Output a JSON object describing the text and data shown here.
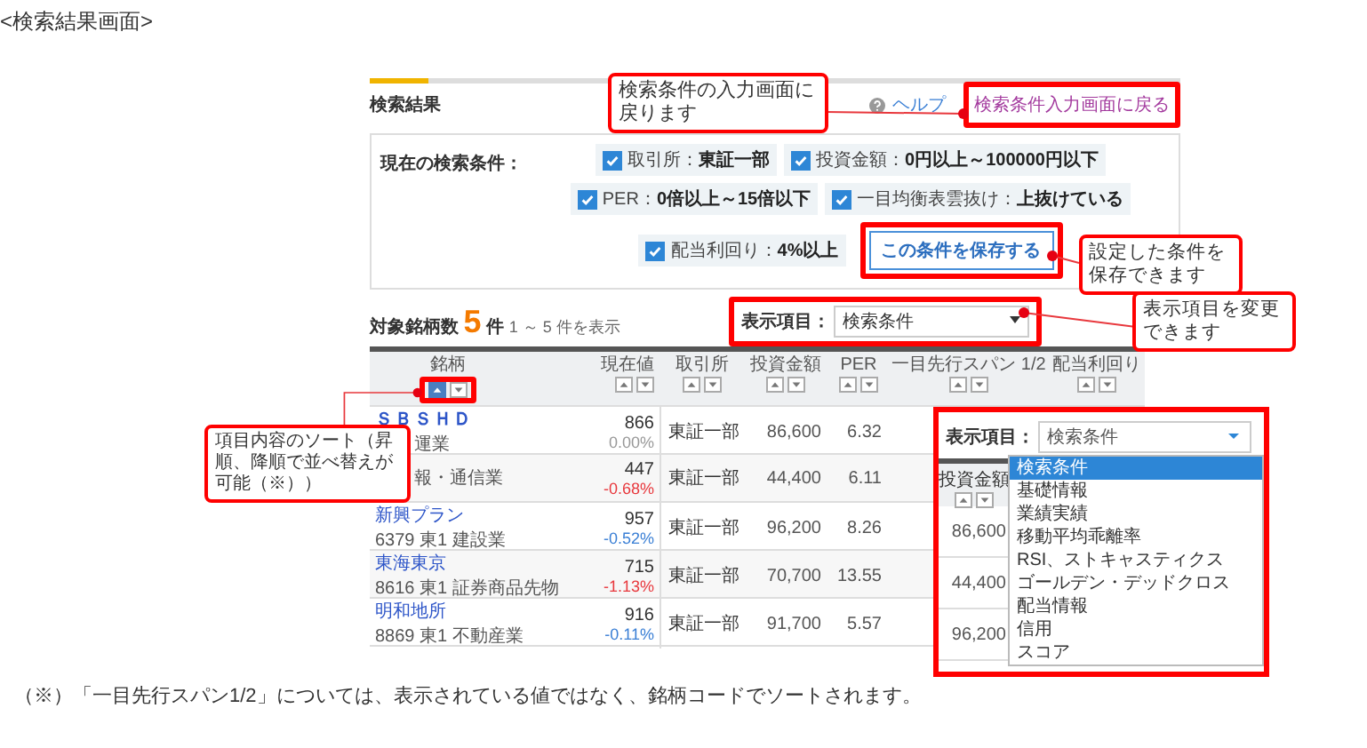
{
  "heading": "<検索結果画面>",
  "panel": {
    "title": "検索結果",
    "help_link": "ヘルプ",
    "back_link": "検索条件入力画面に戻る",
    "conditions": {
      "label": "現在の検索条件：",
      "items": [
        {
          "name": "取引所：",
          "value": "東証一部",
          "checked": true
        },
        {
          "name": "投資金額：",
          "value": "0円以上～100000円以下",
          "checked": true
        },
        {
          "name": "PER：",
          "value": "0倍以上～15倍以下",
          "checked": true
        },
        {
          "name": "一目均衡表雲抜け：",
          "value": "上抜けている",
          "checked": true
        },
        {
          "name": "配当利回り：",
          "value": "4%以上",
          "checked": true
        }
      ],
      "save_button": "この条件を保存する"
    },
    "count": {
      "label": "対象銘柄数",
      "number": "5",
      "unit": "件",
      "range": "1 ～ 5 件を表示"
    },
    "display_select": {
      "label": "表示項目：",
      "value": "検索条件"
    },
    "table": {
      "columns": [
        {
          "label": "銘柄",
          "sorted": true
        },
        {
          "label": "現在値",
          "sorted": false
        },
        {
          "label": "取引所",
          "sorted": false
        },
        {
          "label": "投資金額",
          "sorted": false
        },
        {
          "label": "PER",
          "sorted": false
        },
        {
          "label": "一目先行スパン 1/2",
          "sorted": false
        },
        {
          "label": "配当利回り",
          "sorted": false
        }
      ],
      "rows": [
        {
          "name": "ＳＢＳＨＤ",
          "sub": "運業",
          "covered": true,
          "price": "866",
          "change": "0.00%",
          "color": "#999999",
          "market": "東証一部",
          "amount": "86,600",
          "per": "6.32"
        },
        {
          "sub": "報・通信業",
          "covered": true,
          "price": "447",
          "change": "-0.68%",
          "color": "#e8383d",
          "market": "東証一部",
          "amount": "44,400",
          "per": "6.11"
        },
        {
          "name": "新興プラン",
          "sub": "6379 東1 建設業",
          "covered": false,
          "price": "957",
          "change": "-0.52%",
          "color": "#3a7fd5",
          "market": "東証一部",
          "amount": "96,200",
          "per": "8.26"
        },
        {
          "name": "東海東京",
          "sub": "8616 東1 証券商品先物",
          "covered": false,
          "price": "715",
          "change": "-1.13%",
          "color": "#e8383d",
          "market": "東証一部",
          "amount": "70,700",
          "per": "13.55"
        },
        {
          "name": "明和地所",
          "sub": "8869 東1 不動産業",
          "covered": false,
          "price": "916",
          "change": "-0.11%",
          "color": "#3a7fd5",
          "market": "東証一部",
          "amount": "91,700",
          "per": "5.57"
        }
      ]
    }
  },
  "callouts": [
    {
      "text": "検索条件の入力画面に戻ります"
    },
    {
      "text": "設定した条件を保存できます"
    },
    {
      "text": "表示項目を変更できます"
    },
    {
      "text": "項目内容のソート（昇順、降順で並べ替えが可能（※））"
    }
  ],
  "dropdown_inset": {
    "label": "表示項目：",
    "value": "検索条件",
    "options": [
      {
        "label": "検索条件",
        "selected": true
      },
      {
        "label": "基礎情報",
        "selected": false
      },
      {
        "label": "業績実績",
        "selected": false
      },
      {
        "label": "移動平均乖離率",
        "selected": false
      },
      {
        "label": "RSI、ストキャスティクス",
        "selected": false
      },
      {
        "label": "ゴールデン・デッドクロス",
        "selected": false
      },
      {
        "label": "配当情報",
        "selected": false
      },
      {
        "label": "信用",
        "selected": false
      },
      {
        "label": "スコア",
        "selected": false
      }
    ],
    "column": "投資金額",
    "values": [
      "86,600",
      "44,400",
      "96,200"
    ]
  },
  "footnote": "（※）「一目先行スパン1/2」については、表示されている値ではなく、銘柄コードでソートされます。"
}
